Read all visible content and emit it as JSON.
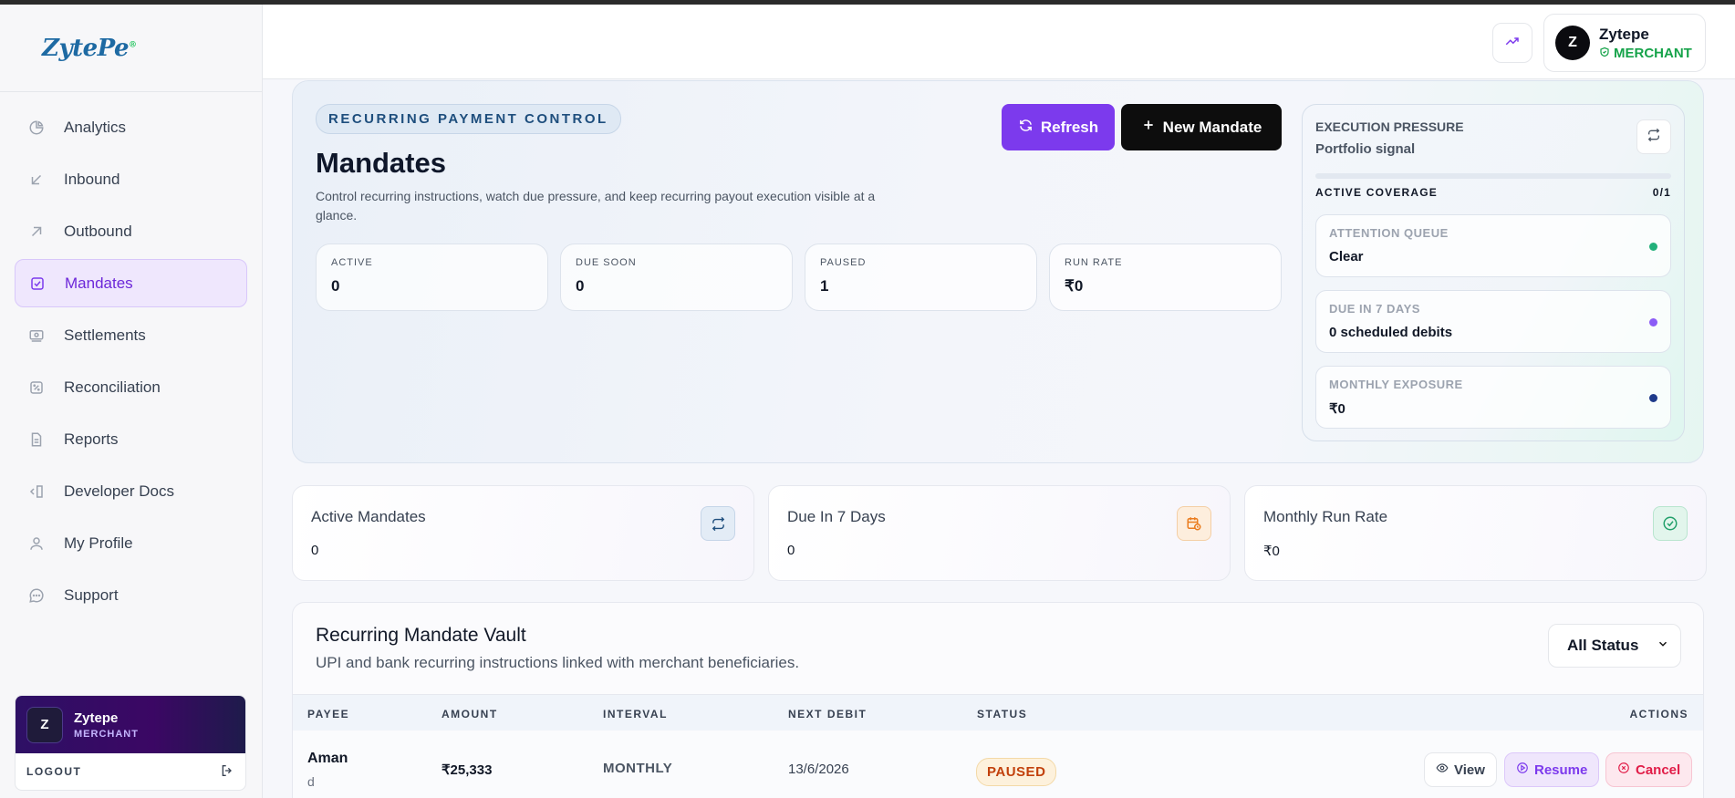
{
  "brand": {
    "logo": "ZytePe",
    "reg": "®"
  },
  "sidebar": {
    "items": [
      {
        "label": "Analytics",
        "icon": "pie-chart-icon"
      },
      {
        "label": "Inbound",
        "icon": "arrow-down-left-icon"
      },
      {
        "label": "Outbound",
        "icon": "arrow-up-right-icon"
      },
      {
        "label": "Mandates",
        "icon": "checkbox-icon",
        "active": true
      },
      {
        "label": "Settlements",
        "icon": "cash-icon"
      },
      {
        "label": "Reconciliation",
        "icon": "percent-icon"
      },
      {
        "label": "Reports",
        "icon": "document-icon"
      },
      {
        "label": "Developer Docs",
        "icon": "code-doc-icon"
      },
      {
        "label": "My Profile",
        "icon": "user-icon"
      },
      {
        "label": "Support",
        "icon": "chat-icon"
      }
    ],
    "user": {
      "initial": "Z",
      "name": "Zytepe",
      "role": "MERCHANT"
    },
    "logout_label": "LOGOUT"
  },
  "header": {
    "profile": {
      "initial": "Z",
      "name": "Zytepe",
      "role": "MERCHANT"
    }
  },
  "hero": {
    "tag": "RECURRING PAYMENT CONTROL",
    "title": "Mandates",
    "description": "Control recurring instructions, watch due pressure, and keep recurring payout execution visible at a glance.",
    "refresh_label": "Refresh",
    "new_label": "New Mandate",
    "kpis": [
      {
        "label": "ACTIVE",
        "value": "0"
      },
      {
        "label": "DUE SOON",
        "value": "0"
      },
      {
        "label": "PAUSED",
        "value": "1"
      },
      {
        "label": "RUN RATE",
        "value": "₹0"
      }
    ],
    "pressure": {
      "title": "EXECUTION PRESSURE",
      "subtitle": "Portfolio signal",
      "coverage_label": "ACTIVE COVERAGE",
      "coverage_value": "0/1",
      "coverage_fraction": 0,
      "items": [
        {
          "label": "ATTENTION QUEUE",
          "value": "Clear",
          "dot": "#22b07a"
        },
        {
          "label": "DUE IN 7 DAYS",
          "value": "0 scheduled debits",
          "dot": "#8b5cf6"
        },
        {
          "label": "MONTHLY EXPOSURE",
          "value": "₹0",
          "dot": "#1e3a8a"
        }
      ]
    }
  },
  "stats": [
    {
      "label": "Active Mandates",
      "value": "0",
      "icon": "repeat-icon"
    },
    {
      "label": "Due In 7 Days",
      "value": "0",
      "icon": "calendar-clock-icon"
    },
    {
      "label": "Monthly Run Rate",
      "value": "₹0",
      "icon": "check-circle-icon"
    }
  ],
  "vault": {
    "title": "Recurring Mandate Vault",
    "subtitle": "UPI and bank recurring instructions linked with merchant beneficiaries.",
    "filter": "All Status",
    "columns": [
      "PAYEE",
      "AMOUNT",
      "INTERVAL",
      "NEXT DEBIT",
      "STATUS",
      "ACTIONS"
    ],
    "rows": [
      {
        "payee": "Aman",
        "payee_sub": "d",
        "amount": "₹25,333",
        "interval": "MONTHLY",
        "next_debit": "13/6/2026",
        "status": "PAUSED",
        "actions": [
          "View",
          "Resume",
          "Cancel"
        ]
      }
    ]
  }
}
